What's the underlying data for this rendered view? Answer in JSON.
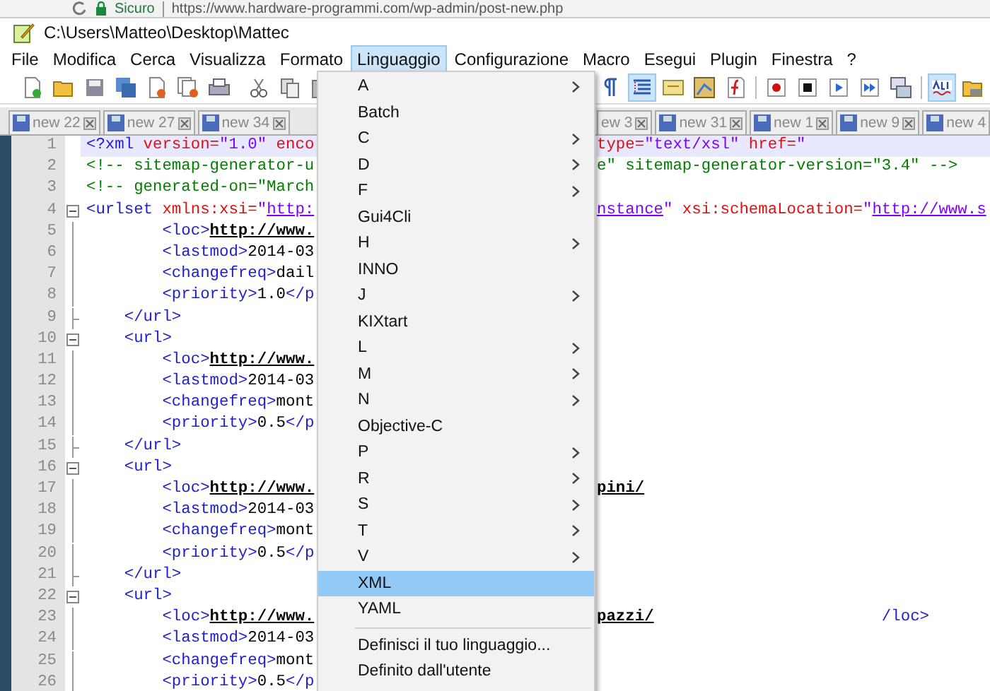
{
  "browser": {
    "security": "Sicuro",
    "url": "https://www.hardware-programmi.com/wp-admin/post-new.php"
  },
  "window": {
    "title": "C:\\Users\\Matteo\\Desktop\\Mattec"
  },
  "menubar": [
    {
      "label": "File",
      "selected": false
    },
    {
      "label": "Modifica",
      "selected": false
    },
    {
      "label": "Cerca",
      "selected": false
    },
    {
      "label": "Visualizza",
      "selected": false
    },
    {
      "label": "Formato",
      "selected": false
    },
    {
      "label": "Linguaggio",
      "selected": true
    },
    {
      "label": "Configurazione",
      "selected": false
    },
    {
      "label": "Macro",
      "selected": false
    },
    {
      "label": "Esegui",
      "selected": false
    },
    {
      "label": "Plugin",
      "selected": false
    },
    {
      "label": "Finestra",
      "selected": false
    },
    {
      "label": "?",
      "selected": false
    }
  ],
  "toolbar": {
    "left": [
      {
        "kind": "new",
        "on": false
      },
      {
        "kind": "open",
        "on": false
      },
      {
        "kind": "save",
        "on": false
      },
      {
        "kind": "save-all",
        "on": false
      },
      {
        "kind": "close",
        "on": false
      },
      {
        "kind": "close-all",
        "on": false
      },
      {
        "kind": "print",
        "on": false
      },
      {
        "kind": "separator"
      },
      {
        "kind": "cut",
        "on": false
      },
      {
        "kind": "copy",
        "on": false
      },
      {
        "kind": "paste",
        "on": false
      }
    ],
    "right": [
      {
        "kind": "pilcrow",
        "on": false
      },
      {
        "kind": "indent-guide",
        "on": true
      },
      {
        "kind": "wrap",
        "on": false
      },
      {
        "kind": "map",
        "on": false
      },
      {
        "kind": "function",
        "on": false
      },
      {
        "kind": "separator"
      },
      {
        "kind": "record",
        "on": false
      },
      {
        "kind": "stop",
        "on": false
      },
      {
        "kind": "play",
        "on": false
      },
      {
        "kind": "play-multiple",
        "on": false
      },
      {
        "kind": "save-macro",
        "on": false
      },
      {
        "kind": "separator"
      },
      {
        "kind": "spellcheck",
        "on": true
      },
      {
        "kind": "folder",
        "on": false
      }
    ]
  },
  "tabs": {
    "left": [
      {
        "label": "new 22"
      },
      {
        "label": "new 27"
      },
      {
        "label": "new 34"
      }
    ],
    "right": [
      {
        "label": "ew 3"
      },
      {
        "label": "new 31"
      },
      {
        "label": "new 1"
      },
      {
        "label": "new 9"
      },
      {
        "label": "new 4"
      }
    ]
  },
  "lines": [
    {
      "number": "1",
      "current": true,
      "kind": "plain",
      "left": [
        {
          "kind": "tag",
          "text": "<?xml"
        },
        {
          "kind": "attr",
          "text": " version="
        },
        {
          "kind": "value",
          "text": "\"1.0\""
        },
        {
          "kind": "attr",
          "text": " enco"
        }
      ],
      "right": [
        {
          "kind": "attr",
          "text": "type="
        },
        {
          "kind": "value",
          "text": "\"text/xsl\""
        },
        {
          "kind": "attr",
          "text": " href="
        },
        {
          "kind": "value",
          "text": "\""
        }
      ]
    },
    {
      "number": "2",
      "current": false,
      "kind": "plain",
      "left": [
        {
          "kind": "comment",
          "text": "<!-- sitemap-generator-u"
        }
      ],
      "right": [
        {
          "kind": "comment",
          "text": "e\" sitemap-generator-version=\"3.4\" -->"
        }
      ]
    },
    {
      "number": "3",
      "current": false,
      "kind": "plain",
      "left": [
        {
          "kind": "comment",
          "text": "<!-- generated-on=\"March"
        }
      ]
    },
    {
      "number": "4",
      "current": false,
      "kind": "fold-start",
      "left": [
        {
          "kind": "tag",
          "text": "<urlset"
        },
        {
          "kind": "attr",
          "text": " xmlns:xsi="
        },
        {
          "kind": "value",
          "text": "\""
        },
        {
          "kind": "value-link",
          "text": "http:"
        }
      ],
      "right": [
        {
          "kind": "value-link",
          "text": "nstance"
        },
        {
          "kind": "value",
          "text": "\""
        },
        {
          "kind": "attr",
          "text": " xsi:schemaLocation="
        },
        {
          "kind": "value",
          "text": "\""
        },
        {
          "kind": "value-link",
          "text": "http://www.s"
        }
      ]
    },
    {
      "number": "5",
      "current": false,
      "kind": "fold-body",
      "left": [
        {
          "kind": "tag",
          "text": "        <loc>"
        },
        {
          "kind": "link",
          "text": "http://www."
        }
      ]
    },
    {
      "number": "6",
      "current": false,
      "kind": "fold-body",
      "left": [
        {
          "kind": "tag",
          "text": "        <lastmod>"
        },
        {
          "kind": "text",
          "text": "2014-03"
        }
      ]
    },
    {
      "number": "7",
      "current": false,
      "kind": "fold-body",
      "left": [
        {
          "kind": "tag",
          "text": "        <changefreq>"
        },
        {
          "kind": "text",
          "text": "dail"
        }
      ]
    },
    {
      "number": "8",
      "current": false,
      "kind": "fold-body",
      "left": [
        {
          "kind": "tag",
          "text": "        <priority>"
        },
        {
          "kind": "text",
          "text": "1.0"
        },
        {
          "kind": "tag",
          "text": "</p"
        }
      ]
    },
    {
      "number": "9",
      "current": false,
      "kind": "fold-end",
      "left": [
        {
          "kind": "tag",
          "text": "    </url>"
        }
      ]
    },
    {
      "number": "10",
      "current": false,
      "kind": "fold-start",
      "left": [
        {
          "kind": "tag",
          "text": "    <url>"
        }
      ]
    },
    {
      "number": "11",
      "current": false,
      "kind": "fold-body",
      "left": [
        {
          "kind": "tag",
          "text": "        <loc>"
        },
        {
          "kind": "link",
          "text": "http://www."
        }
      ]
    },
    {
      "number": "12",
      "current": false,
      "kind": "fold-body",
      "left": [
        {
          "kind": "tag",
          "text": "        <lastmod>"
        },
        {
          "kind": "text",
          "text": "2014-03"
        }
      ]
    },
    {
      "number": "13",
      "current": false,
      "kind": "fold-body",
      "left": [
        {
          "kind": "tag",
          "text": "        <changefreq>"
        },
        {
          "kind": "text",
          "text": "mont"
        }
      ]
    },
    {
      "number": "14",
      "current": false,
      "kind": "fold-body",
      "left": [
        {
          "kind": "tag",
          "text": "        <priority>"
        },
        {
          "kind": "text",
          "text": "0.5"
        },
        {
          "kind": "tag",
          "text": "</p"
        }
      ]
    },
    {
      "number": "15",
      "current": false,
      "kind": "fold-end",
      "left": [
        {
          "kind": "tag",
          "text": "    </url>"
        }
      ]
    },
    {
      "number": "16",
      "current": false,
      "kind": "fold-start",
      "left": [
        {
          "kind": "tag",
          "text": "    <url>"
        }
      ]
    },
    {
      "number": "17",
      "current": false,
      "kind": "fold-body",
      "left": [
        {
          "kind": "tag",
          "text": "        <loc>"
        },
        {
          "kind": "link",
          "text": "http://www."
        }
      ],
      "right": [
        {
          "kind": "link",
          "text": "pini/"
        }
      ]
    },
    {
      "number": "18",
      "current": false,
      "kind": "fold-body",
      "left": [
        {
          "kind": "tag",
          "text": "        <lastmod>"
        },
        {
          "kind": "text",
          "text": "2014-03"
        }
      ]
    },
    {
      "number": "19",
      "current": false,
      "kind": "fold-body",
      "left": [
        {
          "kind": "tag",
          "text": "        <changefreq>"
        },
        {
          "kind": "text",
          "text": "mont"
        }
      ]
    },
    {
      "number": "20",
      "current": false,
      "kind": "fold-body",
      "left": [
        {
          "kind": "tag",
          "text": "        <priority>"
        },
        {
          "kind": "text",
          "text": "0.5"
        },
        {
          "kind": "tag",
          "text": "</p"
        }
      ]
    },
    {
      "number": "21",
      "current": false,
      "kind": "fold-end",
      "left": [
        {
          "kind": "tag",
          "text": "    </url>"
        }
      ]
    },
    {
      "number": "22",
      "current": false,
      "kind": "fold-start",
      "left": [
        {
          "kind": "tag",
          "text": "    <url>"
        }
      ]
    },
    {
      "number": "23",
      "current": false,
      "kind": "fold-body",
      "left": [
        {
          "kind": "tag",
          "text": "        <loc>"
        },
        {
          "kind": "link",
          "text": "http://www."
        }
      ],
      "right": [
        {
          "kind": "link",
          "text": "pazzi/"
        },
        {
          "kind": "tag-far",
          "text": "/loc>"
        }
      ]
    },
    {
      "number": "24",
      "current": false,
      "kind": "fold-body",
      "left": [
        {
          "kind": "tag",
          "text": "        <lastmod>"
        },
        {
          "kind": "text",
          "text": "2014-03"
        }
      ]
    },
    {
      "number": "25",
      "current": false,
      "kind": "fold-body",
      "left": [
        {
          "kind": "tag",
          "text": "        <changefreq>"
        },
        {
          "kind": "text",
          "text": "mont"
        }
      ]
    },
    {
      "number": "26",
      "current": false,
      "kind": "fold-body",
      "left": [
        {
          "kind": "tag",
          "text": "        <priority>"
        },
        {
          "kind": "text",
          "text": "0.5"
        },
        {
          "kind": "tag",
          "text": "</p"
        }
      ]
    }
  ],
  "language_menu": [
    {
      "kind": "item",
      "label": "A",
      "submenu": true,
      "selected": false
    },
    {
      "kind": "item",
      "label": "Batch",
      "submenu": false,
      "selected": false
    },
    {
      "kind": "item",
      "label": "C",
      "submenu": true,
      "selected": false
    },
    {
      "kind": "item",
      "label": "D",
      "submenu": true,
      "selected": false
    },
    {
      "kind": "item",
      "label": "F",
      "submenu": true,
      "selected": false
    },
    {
      "kind": "item",
      "label": "Gui4Cli",
      "submenu": false,
      "selected": false
    },
    {
      "kind": "item",
      "label": "H",
      "submenu": true,
      "selected": false
    },
    {
      "kind": "item",
      "label": "INNO",
      "submenu": false,
      "selected": false
    },
    {
      "kind": "item",
      "label": "J",
      "submenu": true,
      "selected": false
    },
    {
      "kind": "item",
      "label": "KIXtart",
      "submenu": false,
      "selected": false
    },
    {
      "kind": "item",
      "label": "L",
      "submenu": true,
      "selected": false
    },
    {
      "kind": "item",
      "label": "M",
      "submenu": true,
      "selected": false
    },
    {
      "kind": "item",
      "label": "N",
      "submenu": true,
      "selected": false
    },
    {
      "kind": "item",
      "label": "Objective-C",
      "submenu": false,
      "selected": false
    },
    {
      "kind": "item",
      "label": "P",
      "submenu": true,
      "selected": false
    },
    {
      "kind": "item",
      "label": "R",
      "submenu": true,
      "selected": false
    },
    {
      "kind": "item",
      "label": "S",
      "submenu": true,
      "selected": false
    },
    {
      "kind": "item",
      "label": "T",
      "submenu": true,
      "selected": false
    },
    {
      "kind": "item",
      "label": "V",
      "submenu": true,
      "selected": false
    },
    {
      "kind": "item",
      "label": "XML",
      "submenu": false,
      "selected": true
    },
    {
      "kind": "item",
      "label": "YAML",
      "submenu": false,
      "selected": false
    },
    {
      "kind": "separator"
    },
    {
      "kind": "item",
      "label": "Definisci il tuo linguaggio...",
      "submenu": false,
      "selected": false
    },
    {
      "kind": "item",
      "label": "Definito dall'utente",
      "submenu": false,
      "selected": false
    }
  ]
}
